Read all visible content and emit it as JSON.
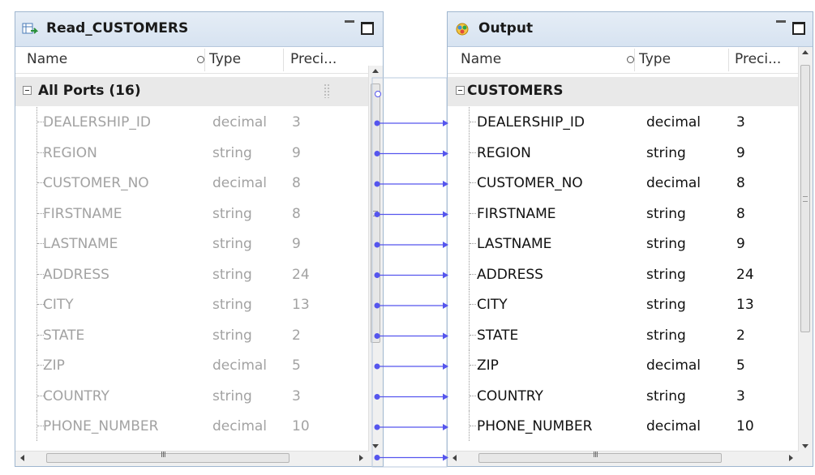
{
  "source_panel": {
    "title": "Read_CUSTOMERS",
    "columns": {
      "name": "Name",
      "type": "Type",
      "precision": "Preci..."
    },
    "group_label": "All Ports (16)",
    "rows": [
      {
        "name": "DEALERSHIP_ID",
        "type": "decimal",
        "precision": "3"
      },
      {
        "name": "REGION",
        "type": "string",
        "precision": "9"
      },
      {
        "name": "CUSTOMER_NO",
        "type": "decimal",
        "precision": "8"
      },
      {
        "name": "FIRSTNAME",
        "type": "string",
        "precision": "8"
      },
      {
        "name": "LASTNAME",
        "type": "string",
        "precision": "9"
      },
      {
        "name": "ADDRESS",
        "type": "string",
        "precision": "24"
      },
      {
        "name": "CITY",
        "type": "string",
        "precision": "13"
      },
      {
        "name": "STATE",
        "type": "string",
        "precision": "2"
      },
      {
        "name": "ZIP",
        "type": "decimal",
        "precision": "5"
      },
      {
        "name": "COUNTRY",
        "type": "string",
        "precision": "3"
      },
      {
        "name": "PHONE_NUMBER",
        "type": "decimal",
        "precision": "10"
      }
    ]
  },
  "target_panel": {
    "title": "Output",
    "columns": {
      "name": "Name",
      "type": "Type",
      "precision": "Preci..."
    },
    "group_label": "CUSTOMERS",
    "rows": [
      {
        "name": "DEALERSHIP_ID",
        "type": "decimal",
        "precision": "3"
      },
      {
        "name": "REGION",
        "type": "string",
        "precision": "9"
      },
      {
        "name": "CUSTOMER_NO",
        "type": "decimal",
        "precision": "8"
      },
      {
        "name": "FIRSTNAME",
        "type": "string",
        "precision": "8"
      },
      {
        "name": "LASTNAME",
        "type": "string",
        "precision": "9"
      },
      {
        "name": "ADDRESS",
        "type": "string",
        "precision": "24"
      },
      {
        "name": "CITY",
        "type": "string",
        "precision": "13"
      },
      {
        "name": "STATE",
        "type": "string",
        "precision": "2"
      },
      {
        "name": "ZIP",
        "type": "decimal",
        "precision": "5"
      },
      {
        "name": "COUNTRY",
        "type": "string",
        "precision": "3"
      },
      {
        "name": "PHONE_NUMBER",
        "type": "decimal",
        "precision": "10"
      }
    ]
  },
  "link_count": 12,
  "colors": {
    "link": "#5555ee",
    "panel_border": "#9fb6cf",
    "title_bg": "#dce6f2",
    "group_bg": "#e9e9e9",
    "disabled_text": "#a2a2a2"
  },
  "icons": {
    "source": "read-source-icon",
    "target": "output-target-icon"
  }
}
